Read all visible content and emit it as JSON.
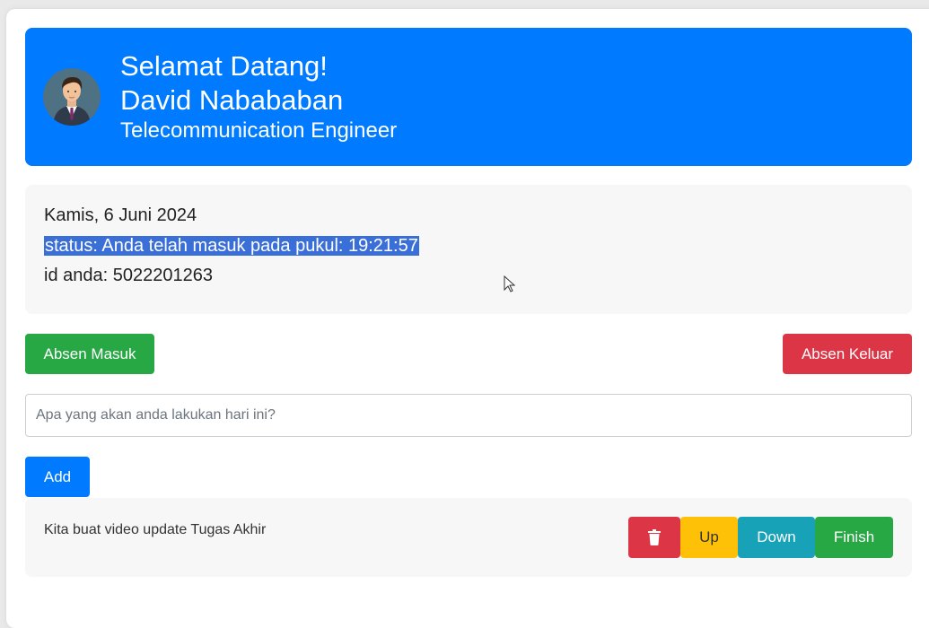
{
  "header": {
    "greeting": "Selamat Datang!",
    "name": "David Nabababan",
    "job_title": "Telecommunication Engineer",
    "accent_color": "#007bff"
  },
  "info": {
    "date": "Kamis, 6 Juni 2024",
    "status": "status: Anda telah masuk pada pukul: 19:21:57",
    "id": "id anda: 5022201263"
  },
  "actions": {
    "check_in_label": "Absen Masuk",
    "check_out_label": "Absen Keluar",
    "check_in_color": "#28a745",
    "check_out_color": "#dc3545"
  },
  "task_input": {
    "value": "",
    "placeholder": "Apa yang akan anda lakukan hari ini?"
  },
  "add_button": {
    "label": "Add"
  },
  "tasks": [
    {
      "text": "Kita buat video update Tugas Akhir",
      "delete_icon": "trash-icon",
      "up_label": "Up",
      "down_label": "Down",
      "finish_label": "Finish"
    }
  ]
}
